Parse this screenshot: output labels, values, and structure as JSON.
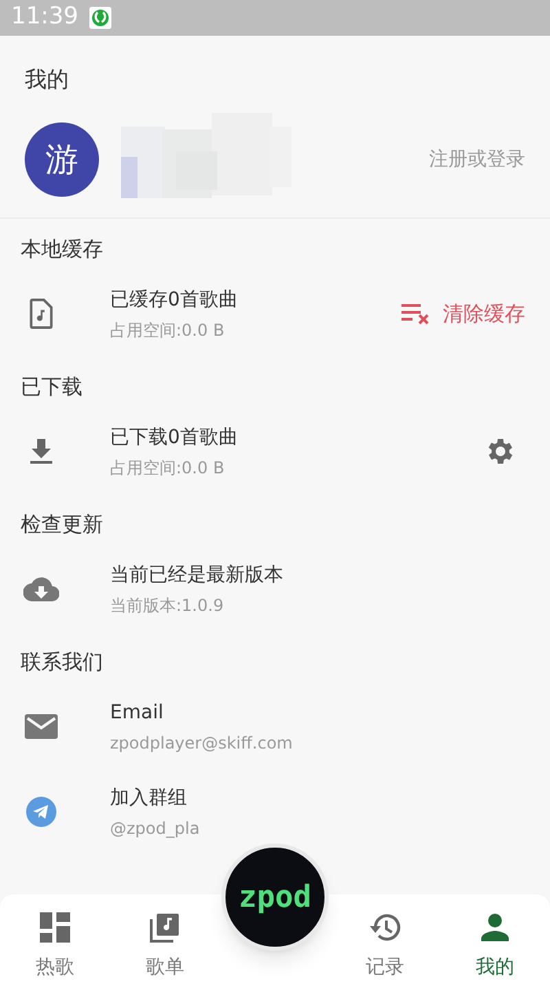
{
  "status_bar": {
    "time": "11:39"
  },
  "header": {
    "title": "我的"
  },
  "profile": {
    "avatar_text": "游",
    "login": "注册或登录"
  },
  "sections": [
    {
      "title": "本地缓存",
      "items": [
        {
          "kind": "music-file",
          "title": "已缓存0首歌曲",
          "subtitle": "占用空间:0.0 B",
          "action": {
            "kind": "clear",
            "label": "清除缓存"
          }
        }
      ]
    },
    {
      "title": "已下载",
      "items": [
        {
          "kind": "download",
          "title": "已下载0首歌曲",
          "subtitle": "占用空间:0.0 B",
          "action": {
            "kind": "settings"
          }
        }
      ]
    },
    {
      "title": "检查更新",
      "items": [
        {
          "kind": "cloud",
          "title": "当前已经是最新版本",
          "subtitle": "当前版本:1.0.9"
        }
      ]
    },
    {
      "title": "联系我们",
      "items": [
        {
          "kind": "mail",
          "title": "Email",
          "subtitle": "zpodplayer@skiff.com"
        },
        {
          "kind": "telegram",
          "title": "加入群组",
          "subtitle": "@zpod_pla"
        }
      ]
    }
  ],
  "player": {
    "label": "zpod"
  },
  "nav": [
    {
      "kind": "grid",
      "label": "热歌",
      "selected": false
    },
    {
      "kind": "playlist",
      "label": "歌单",
      "selected": false
    },
    {
      "kind": "history",
      "label": "记录",
      "selected": false
    },
    {
      "kind": "person",
      "label": "我的",
      "selected": true
    }
  ]
}
